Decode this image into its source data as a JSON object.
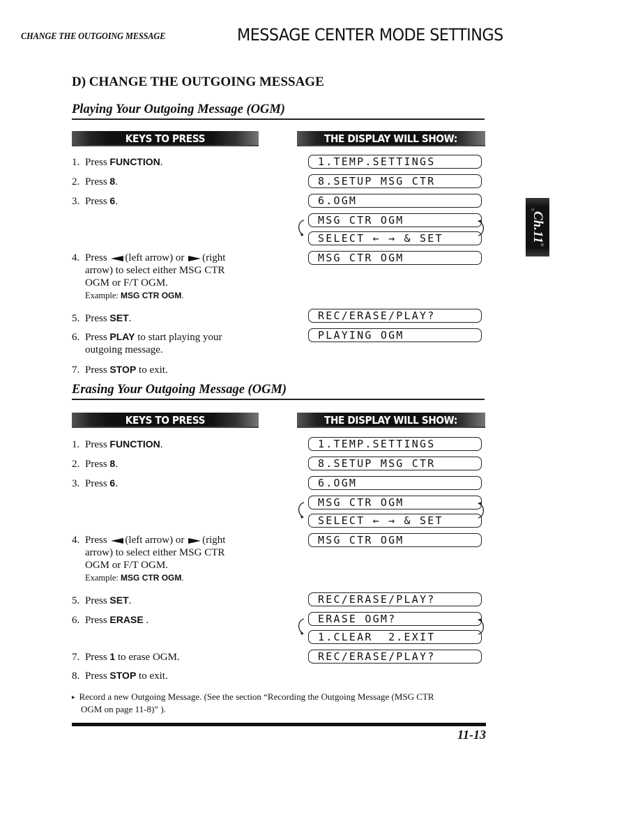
{
  "header": {
    "running_head": "CHANGE THE OUTGOING MESSAGE",
    "mode_title": "MESSAGE CENTER MODE SETTINGS"
  },
  "section_title": "D) CHANGE THE OUTGOING MESSAGE",
  "chapter_tab": "Ch.11",
  "banners": {
    "keys": "KEYS TO PRESS",
    "display": "THE DISPLAY WILL SHOW:"
  },
  "playing": {
    "title": "Playing Your Outgoing Message (OGM)",
    "steps": [
      {
        "num": "1.",
        "pre": "Press ",
        "key": "FUNCTION",
        "post": "."
      },
      {
        "num": "2.",
        "pre": "Press ",
        "key": "8",
        "post": "."
      },
      {
        "num": "3.",
        "pre": "Press ",
        "key": "6",
        "post": "."
      },
      {
        "num": "4.",
        "pre": "Press ",
        "left_label": "(left arrow) or ",
        "right_label": "(right",
        "line2": "arrow) to select either MSG CTR",
        "line3": "OGM or F/T OGM.",
        "example_label": "Example: ",
        "example_key": "MSG CTR OGM",
        "example_post": "."
      },
      {
        "num": "5.",
        "pre": "Press ",
        "key": "SET",
        "post": "."
      },
      {
        "num": "6.",
        "pre": "Press ",
        "key": "PLAY",
        "post": " to start playing your",
        "line2": "outgoing message."
      },
      {
        "num": "7.",
        "pre": "Press ",
        "key": "STOP",
        "post": " to exit."
      }
    ],
    "lcd": [
      "1.TEMP.SETTINGS",
      "8.SETUP MSG CTR",
      "6.OGM",
      "MSG CTR OGM",
      "SELECT ← → & SET",
      "MSG CTR OGM",
      "REC/ERASE/PLAY?",
      "PLAYING OGM"
    ]
  },
  "erasing": {
    "title": "Erasing Your Outgoing Message (OGM)",
    "steps": [
      {
        "num": "1.",
        "pre": "Press ",
        "key": "FUNCTION",
        "post": "."
      },
      {
        "num": "2.",
        "pre": "Press ",
        "key": "8",
        "post": "."
      },
      {
        "num": "3.",
        "pre": "Press ",
        "key": "6",
        "post": "."
      },
      {
        "num": "4.",
        "pre": "Press ",
        "left_label": "(left arrow) or ",
        "right_label": "(right",
        "line2": "arrow) to select either MSG CTR",
        "line3": "OGM or F/T OGM.",
        "example_label": "Example: ",
        "example_key": "MSG CTR OGM",
        "example_post": "."
      },
      {
        "num": "5.",
        "pre": "Press ",
        "key": "SET",
        "post": "."
      },
      {
        "num": "6.",
        "pre": "Press ",
        "key": "ERASE",
        "post": " ."
      },
      {
        "num": "7.",
        "pre": "Press ",
        "key": "1",
        "post": " to erase OGM."
      },
      {
        "num": "8.",
        "pre": "Press ",
        "key": "STOP",
        "post": " to exit."
      }
    ],
    "lcd": [
      "1.TEMP.SETTINGS",
      "8.SETUP MSG CTR",
      "6.OGM",
      "MSG CTR OGM",
      "SELECT ← → & SET",
      "MSG CTR OGM",
      "REC/ERASE/PLAY?",
      "ERASE OGM?",
      "1.CLEAR  2.EXIT",
      "REC/ERASE/PLAY?"
    ]
  },
  "note": {
    "bullet": "▸",
    "line1": "Record a new Outgoing Message. (See the section “Recording the Outgoing Message (MSG CTR",
    "line2": "OGM on page 11-8)” )."
  },
  "footer": {
    "page_number": "11-13"
  }
}
